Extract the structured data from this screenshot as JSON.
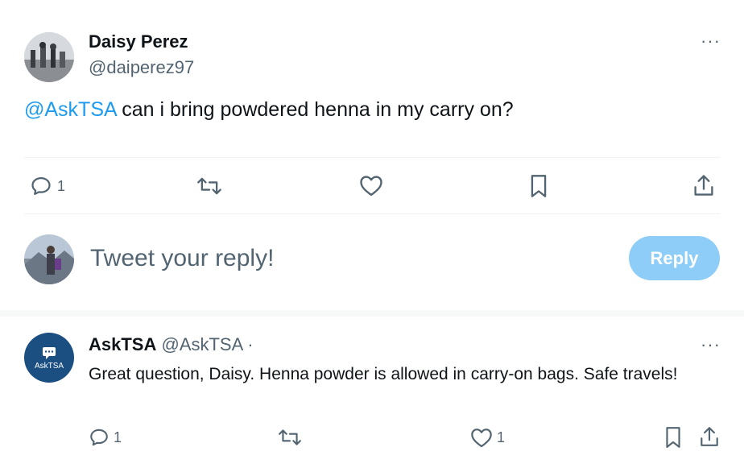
{
  "main_tweet": {
    "author_name": "Daisy Perez",
    "author_handle": "@daiperez97",
    "mention": "@AskTSA",
    "text": " can i bring powdered henna in my carry on?",
    "reply_count": "1"
  },
  "composer": {
    "placeholder": "Tweet your reply!",
    "reply_button": "Reply"
  },
  "reply_tweet": {
    "author_name": "AskTSA",
    "author_handle": "@AskTSA",
    "separator": "·",
    "text": "Great question, Daisy. Henna powder is allowed in carry-on bags. Safe travels!",
    "reply_count": "1",
    "like_count": "1",
    "avatar_label": "AskTSA"
  },
  "colors": {
    "accent": "#1d9bf0",
    "reply_button_bg": "#8ecdf8",
    "tsa_avatar_bg": "#1b4f82",
    "muted": "#536471"
  }
}
